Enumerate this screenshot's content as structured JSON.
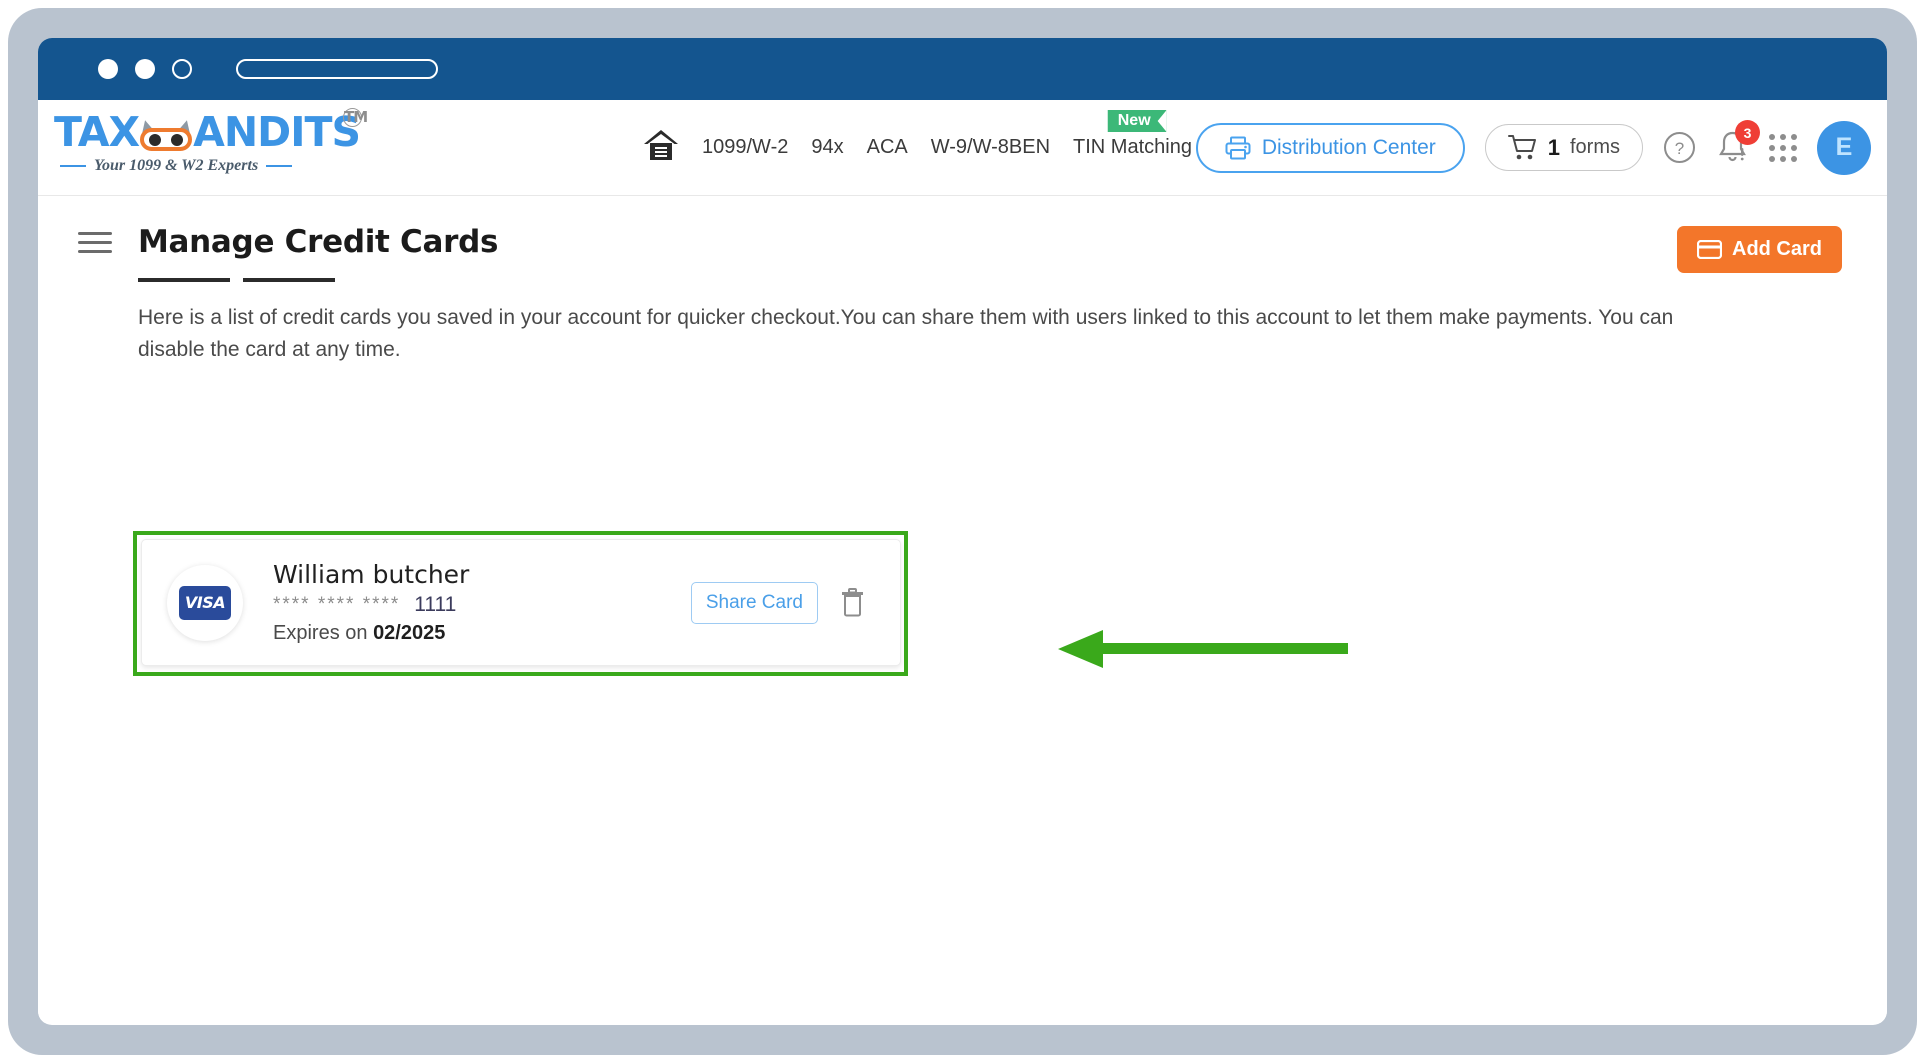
{
  "browser": {
    "dots": [
      "close-dot",
      "minimize-dot",
      "maximize-dot"
    ],
    "url_value": ""
  },
  "header": {
    "logo": {
      "text_left": "TAX",
      "text_right": "ANDITS",
      "trademark": "TM",
      "tagline": "Your 1099 & W2 Experts"
    },
    "nav": [
      {
        "label": "",
        "icon": "home-icon",
        "badge": null
      },
      {
        "label": "1099/W-2",
        "icon": null,
        "badge": null
      },
      {
        "label": "94x",
        "icon": null,
        "badge": null
      },
      {
        "label": "ACA",
        "icon": null,
        "badge": null
      },
      {
        "label": "W-9/W-8BEN",
        "icon": null,
        "badge": null
      },
      {
        "label": "TIN Matching",
        "icon": null,
        "badge": "New"
      }
    ],
    "distribution_center": {
      "label": "Distribution Center",
      "icon": "printer-icon"
    },
    "cart": {
      "count": "1",
      "unit": "forms",
      "icon": "cart-icon"
    },
    "help_icon": "help-circle-icon",
    "notifications": {
      "icon": "bell-icon",
      "badge": "3"
    },
    "apps_icon": "apps-grid-icon",
    "avatar": {
      "initial": "E"
    }
  },
  "page": {
    "title": "Manage Credit Cards",
    "menu_icon": "hamburger-icon",
    "add_card": {
      "label": "Add Card",
      "icon": "credit-card-icon",
      "color": "#f3762a"
    },
    "description": "Here is a list of credit cards you saved in your account for quicker checkout.You can share them with users linked to this account to let them make payments. You can disable the card at any time."
  },
  "cards": [
    {
      "brand": "VISA",
      "holder": "William butcher",
      "masked": "**** **** ****",
      "last4": "1111",
      "expiry_label": "Expires on",
      "expiry_value": "02/2025",
      "share_label": "Share Card",
      "delete_icon": "trash-icon"
    }
  ],
  "annotation": {
    "highlight_color": "#3aa91b",
    "arrow_color": "#3aa91b",
    "arrow_direction": "left"
  }
}
